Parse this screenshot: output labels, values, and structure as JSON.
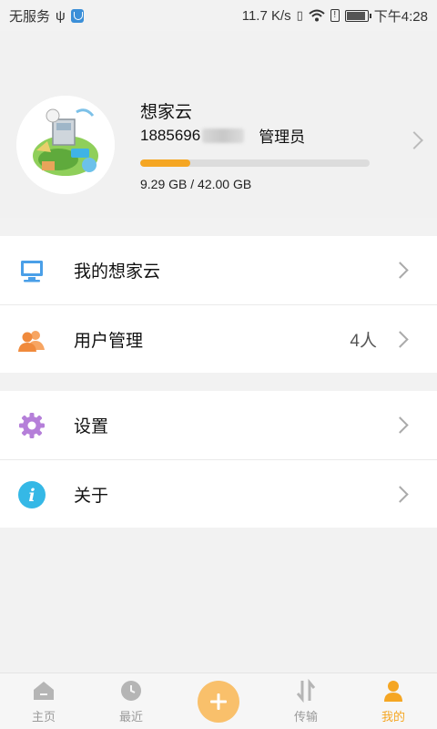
{
  "status_bar": {
    "carrier": "无服务",
    "speed": "11.7 K/s",
    "time": "下午4:28"
  },
  "profile": {
    "name": "想家云",
    "phone": "1885696",
    "role": "管理员",
    "storage_text": "9.29 GB / 42.00 GB",
    "storage_used_fraction": 0.22
  },
  "menu": {
    "group1": [
      {
        "label": "我的想家云",
        "value": "",
        "icon": "computer-icon"
      },
      {
        "label": "用户管理",
        "value": "4人",
        "icon": "users-icon"
      }
    ],
    "group2": [
      {
        "label": "设置",
        "icon": "gear-icon"
      },
      {
        "label": "关于",
        "icon": "info-icon"
      }
    ]
  },
  "bottom_nav": {
    "home": "主页",
    "recent": "最近",
    "add": "+",
    "transfer": "传输",
    "mine": "我的"
  },
  "colors": {
    "accent": "#f5a623",
    "fab": "#f9c06b",
    "inactive": "#9a9a9a"
  }
}
